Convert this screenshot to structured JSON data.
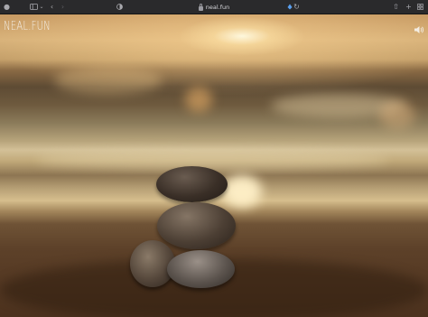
{
  "browser": {
    "url": "neal.fun",
    "icons": [
      "sidebar-icon",
      "chevron-down-icon",
      "back-icon",
      "forward-icon",
      "privacy-shield-icon",
      "extension-icon",
      "refresh-icon",
      "share-icon",
      "new-tab-icon",
      "tab-overview-icon"
    ]
  },
  "page": {
    "logo": "NEAL.FUN",
    "sound_icon": "speaker-icon",
    "image": "stacked-stones-beach-sunset"
  },
  "colors": {
    "chrome": "#2a2a2c",
    "sun": "#fff4d8",
    "stone_dark": "#2e2620",
    "logo": "#f3ede3"
  }
}
